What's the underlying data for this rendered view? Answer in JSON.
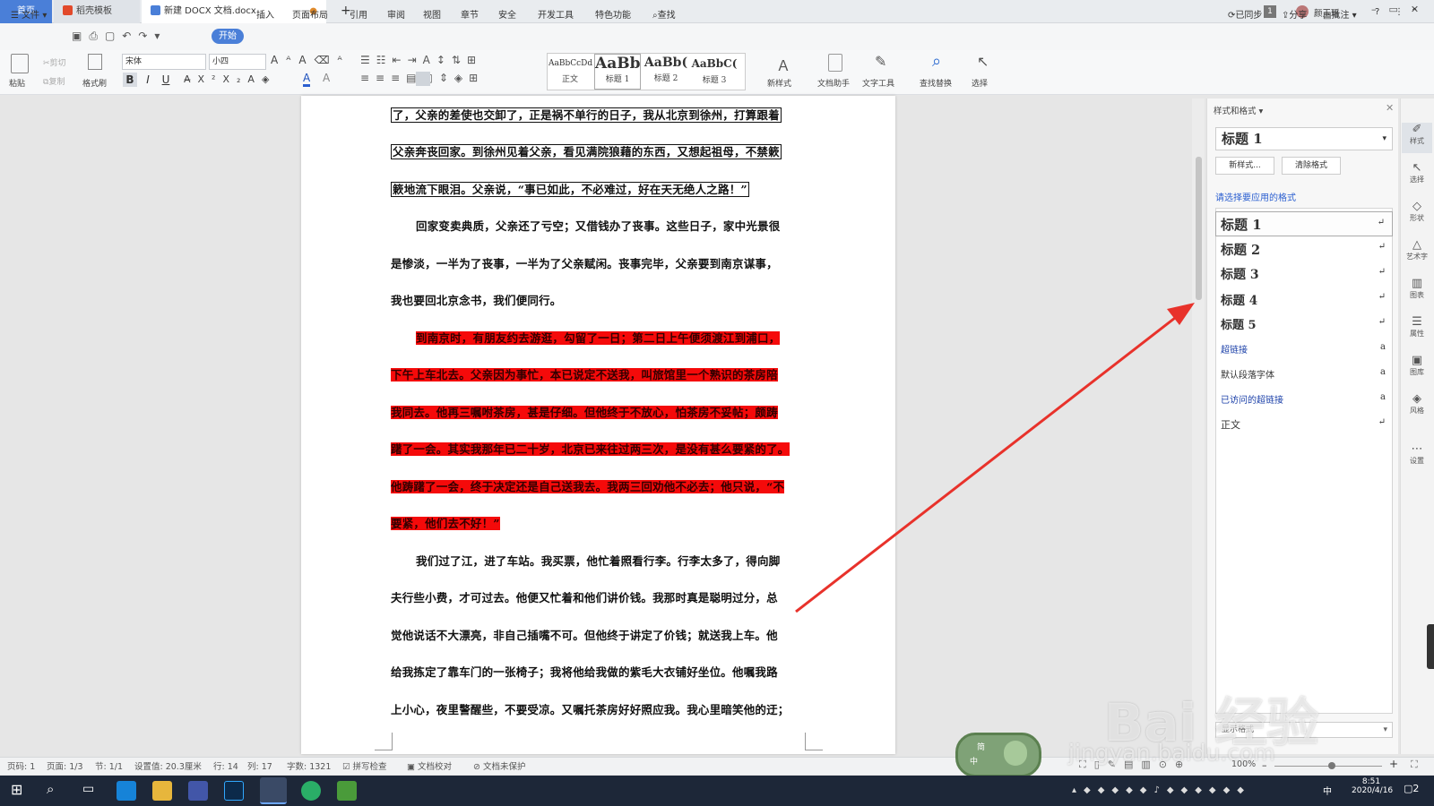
{
  "tabs": {
    "home": "首页",
    "template": "稻壳模板",
    "doc": "新建 DOCX 文档.docx",
    "add": "+"
  },
  "window": {
    "badge": "1",
    "user": "颜玉瑶"
  },
  "menu": {
    "file": "文件",
    "items": [
      "开始",
      "插入",
      "页面布局",
      "引用",
      "审阅",
      "视图",
      "章节",
      "安全",
      "开发工具",
      "特色功能"
    ],
    "search": "查找",
    "sync": "已同步",
    "share": "分享",
    "comment": "批注",
    "help": "?"
  },
  "ribbon": {
    "paste": "粘贴",
    "cut": "剪切",
    "copy": "复制",
    "format_painter": "格式刷",
    "font": "宋体",
    "size": "小四",
    "styles": [
      {
        "preview": "AaBbCcDd",
        "name": "正文"
      },
      {
        "preview": "AaBb",
        "name": "标题 1"
      },
      {
        "preview": "AaBb(",
        "name": "标题 2"
      },
      {
        "preview": "AaBbC(",
        "name": "标题 3"
      }
    ],
    "new_style": "新样式",
    "doc_helper": "文档助手",
    "text_tools": "文字工具",
    "find_replace": "查找替换",
    "select": "选择"
  },
  "document": {
    "lines": [
      "了，父亲的差使也交卸了，正是祸不单行的日子，我从北京到徐州，打算跟着",
      "父亲奔丧回家。到徐州见着父亲，看见满院狼藉的东西，又想起祖母，不禁簌",
      "簌地流下眼泪。父亲说，“事已如此，不必难过，好在天无绝人之路！”",
      "回家变卖典质，父亲还了亏空；又借钱办了丧事。这些日子，家中光景很",
      "是惨淡，一半为了丧事，一半为了父亲赋闲。丧事完毕，父亲要到南京谋事，",
      "我也要回北京念书，我们便同行。",
      "到南京时，有朋友约去游逛，勾留了一日；第二日上午便须渡江到浦口，",
      "下午上车北去。父亲因为事忙，本已说定不送我，叫旅馆里一个熟识的茶房陪",
      "我同去。他再三嘱咐茶房，甚是仔细。但他终于不放心，怕茶房不妥帖；颇踌",
      "躇了一会。其实我那年已二十岁，北京已来往过两三次，是没有甚么要紧的了。",
      "他踌躇了一会，终于决定还是自己送我去。我两三回劝他不必去；他只说，“不",
      "要紧，他们去不好！”",
      "我们过了江，进了车站。我买票，他忙着照看行李。行李太多了，得向脚",
      "夫行些小费，才可过去。他便又忙着和他们讲价钱。我那时真是聪明过分，总",
      "觉他说话不大漂亮，非自己插嘴不可。但他终于讲定了价钱；就送我上车。他",
      "给我拣定了靠车门的一张椅子；我将他给我做的紫毛大衣铺好坐位。他嘱我路",
      "上小心，夜里警醒些，不要受凉。又嘱托茶房好好照应我。我心里暗笑他的迂；"
    ]
  },
  "panel": {
    "title": "样式和格式",
    "current": "标题  1",
    "new_style": "新样式...",
    "clear": "清除格式",
    "hint": "请选择要应用的格式",
    "styles": [
      "标题  1",
      "标题  2",
      "标题  3",
      "标题  4",
      "标题  5",
      "超链接",
      "默认段落字体",
      "已访问的超链接",
      "正文"
    ],
    "show": "显示格式"
  },
  "sidebar": [
    "样式",
    "选择",
    "形状",
    "艺术字",
    "图表",
    "属性",
    "图库",
    "风格",
    "设置"
  ],
  "status": {
    "page_code": "页码: 1",
    "pages": "页面: 1/3",
    "section": "节: 1/1",
    "setting": "设置值: 20.3厘米",
    "row": "行: 14",
    "col": "列: 17",
    "words": "字数: 1321",
    "spell": "拼写检查",
    "proof": "文档校对",
    "protect": "文档未保护",
    "zoom": "100%"
  },
  "ime": {
    "a": "简",
    "b": "中"
  },
  "taskbar": {
    "time": "8:51",
    "date": "2020/4/16",
    "ime": "中",
    "notify": "2"
  },
  "watermark": "Bai 经验",
  "watermark_url": "jingyan.baidu.com",
  "colors": {
    "accent": "#4a7fd8",
    "highlight": "#f50a0a",
    "arrow": "#e8322b"
  }
}
